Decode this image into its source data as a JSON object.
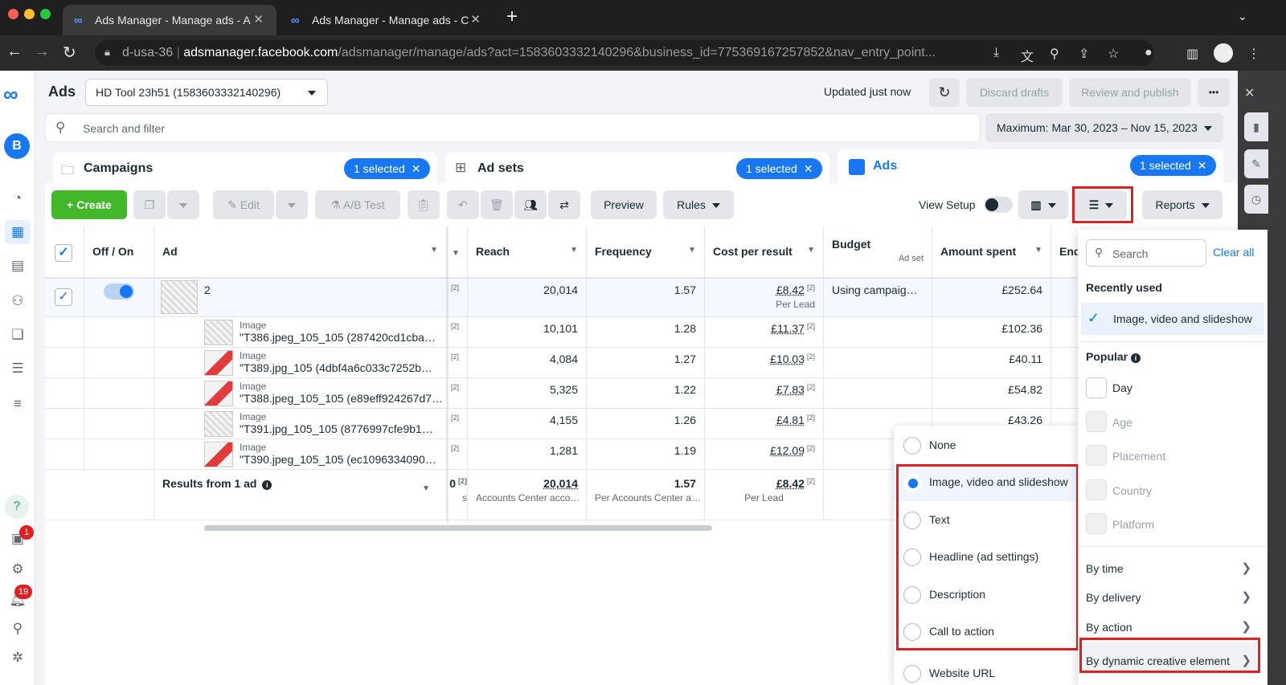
{
  "browser": {
    "tabs": [
      {
        "title": "Ads Manager - Manage ads - A"
      },
      {
        "title": "Ads Manager - Manage ads - C"
      }
    ],
    "url": {
      "host": "d-usa-36",
      "domain": "adsmanager.facebook.com",
      "path": "/adsmanager/manage/ads?act=1583603332140296&business_id=775369167257852&nav_entry_point..."
    }
  },
  "app": {
    "section_title": "Ads",
    "account_selector": "HD Tool 23h51 (1583603332140296)",
    "status": "Updated just now",
    "discard_label": "Discard drafts",
    "review_label": "Review and publish",
    "more_label": "•••",
    "search_placeholder": "Search and filter",
    "date_range": "Maximum: Mar 30, 2023 – Nov 15, 2023",
    "avatar_letter": "B"
  },
  "level_tabs": [
    {
      "label": "Campaigns",
      "selected": "1 selected"
    },
    {
      "label": "Ad sets",
      "selected": "1 selected"
    },
    {
      "label": "Ads",
      "selected": "1 selected"
    }
  ],
  "toolbar": {
    "create": "Create",
    "edit": "Edit",
    "ab_test": "A/B Test",
    "preview": "Preview",
    "rules": "Rules",
    "view_setup": "View Setup",
    "reports": "Reports"
  },
  "table": {
    "headers": {
      "off_on": "Off / On",
      "ad": "Ad",
      "reach": "Reach",
      "frequency": "Frequency",
      "cost_per_result": "Cost per result",
      "budget": "Budget",
      "budget_sub": "Ad set",
      "amount_spent": "Amount spent",
      "end": "End"
    },
    "main_row": {
      "name": "2",
      "ref": "[2]",
      "reach": "20,014",
      "frequency": "1.57",
      "cost": "£8.42",
      "cost_ref": "[2]",
      "cost_sub": "Per Lead",
      "budget": "Using campaig…",
      "spent": "£252.64"
    },
    "sub_rows": [
      {
        "type": "Image",
        "name": "\"T386.jpeg_105_105 (287420cd1cba…",
        "ref": "[2]",
        "reach": "10,101",
        "frequency": "1.28",
        "cost": "£11.37",
        "cost_ref": "[2]",
        "spent": "£102.36"
      },
      {
        "type": "Image",
        "name": "\"T389.jpg_105 (4dbf4a6c033c7252b…",
        "ref": "[2]",
        "reach": "4,084",
        "frequency": "1.27",
        "cost": "£10.03",
        "cost_ref": "[2]",
        "spent": "£40.11"
      },
      {
        "type": "Image",
        "name": "\"T388.jpeg_105_105 (e89eff924267d7…",
        "ref": "[2]",
        "reach": "5,325",
        "frequency": "1.22",
        "cost": "£7.83",
        "cost_ref": "[2]",
        "spent": "£54.82"
      },
      {
        "type": "Image",
        "name": "\"T391.jpg_105_105 (8776997cfe9b1…",
        "ref": "[2]",
        "reach": "4,155",
        "frequency": "1.26",
        "cost": "£4.81",
        "cost_ref": "[2]",
        "spent": "£43.26"
      },
      {
        "type": "Image",
        "name": "\"T390.jpeg_105_105 (ec1096334090…",
        "ref": "[2]",
        "reach": "1,281",
        "frequency": "1.19",
        "cost": "£12.09",
        "cost_ref": "[2]",
        "spent": ""
      }
    ],
    "results": {
      "label": "Results from 1 ad",
      "partial": "0",
      "partial_ref": "[2]",
      "partial_sub": "s",
      "reach": "20,014",
      "reach_sub": "Accounts Center acco…",
      "frequency": "1.57",
      "frequency_sub": "Per Accounts Center a…",
      "cost": "£8.42",
      "cost_ref": "[2]",
      "cost_sub": "Per Lead"
    }
  },
  "dce_menu": {
    "items": [
      {
        "label": "None",
        "selected": false
      },
      {
        "label": "Image, video and slideshow",
        "selected": true
      },
      {
        "label": "Text",
        "selected": false
      },
      {
        "label": "Headline (ad settings)",
        "selected": false
      },
      {
        "label": "Description",
        "selected": false
      },
      {
        "label": "Call to action",
        "selected": false
      },
      {
        "label": "Website URL",
        "selected": false
      }
    ]
  },
  "breakdown_panel": {
    "search_placeholder": "Search",
    "clear_all": "Clear all",
    "recently_used_title": "Recently used",
    "recently_used": [
      "Image, video and slideshow"
    ],
    "popular_title": "Popular",
    "popular": [
      "Day",
      "Age",
      "Placement",
      "Country",
      "Platform"
    ],
    "groups": [
      "By time",
      "By delivery",
      "By action",
      "By dynamic creative element"
    ]
  },
  "badges": {
    "notifications_a": "1",
    "notifications_b": "19"
  },
  "colors": {
    "accent": "#1877f2",
    "highlight": "#e02020",
    "create_green": "#42b72a"
  }
}
